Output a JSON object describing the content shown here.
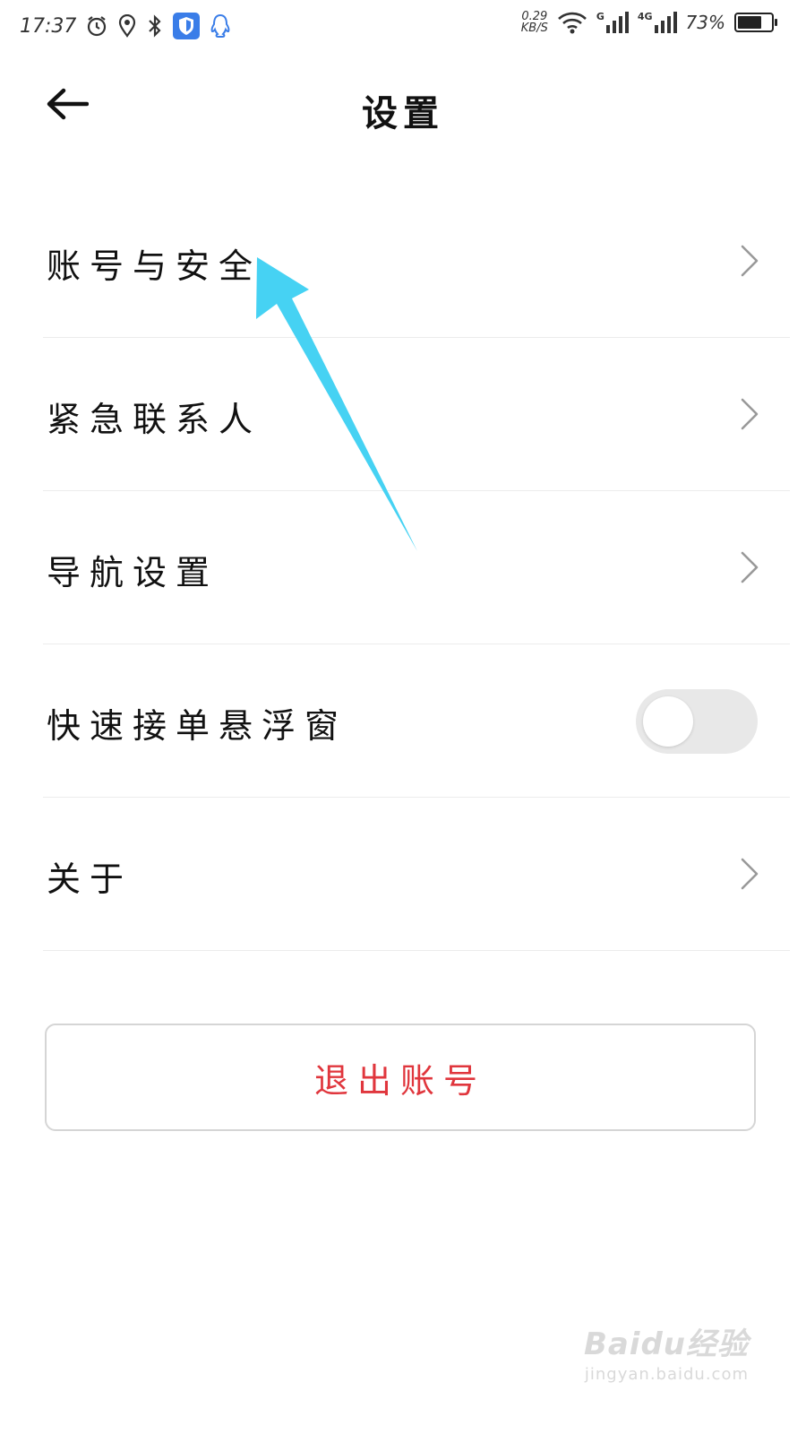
{
  "status_bar": {
    "time": "17:37",
    "net_speed_value": "0.29",
    "net_speed_unit": "KB/S",
    "signal1_label": "G",
    "signal2_label": "4G",
    "battery_percent": "73%",
    "battery_level": 0.73,
    "icons": [
      "alarm-icon",
      "location-icon",
      "bluetooth-icon",
      "shield-app-icon",
      "qq-icon",
      "wifi-icon",
      "signal-icon",
      "battery-icon"
    ]
  },
  "header": {
    "title": "设置",
    "back_icon": "arrow-left-icon"
  },
  "settings": {
    "items": [
      {
        "label": "账号与安全",
        "control": "chevron-right-icon"
      },
      {
        "label": "紧急联系人",
        "control": "chevron-right-icon"
      },
      {
        "label": "导航设置",
        "control": "chevron-right-icon"
      },
      {
        "label": "快速接单悬浮窗",
        "control": "toggle",
        "toggle_on": false
      },
      {
        "label": "关于",
        "control": "chevron-right-icon"
      }
    ]
  },
  "logout": {
    "label": "退出账号",
    "color": "#e0363d"
  },
  "annotation": {
    "arrow_color": "#46d2f3"
  },
  "watermark": {
    "logo": "Baidu经验",
    "url": "jingyan.baidu.com"
  }
}
